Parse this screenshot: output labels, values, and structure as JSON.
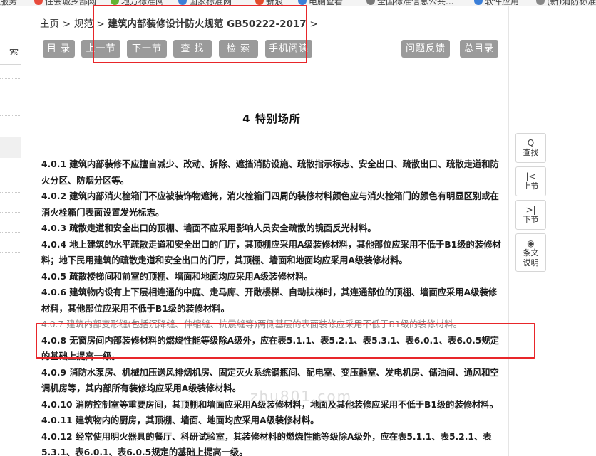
{
  "bookmarks": [
    {
      "label": "服务",
      "color": "#ffffff"
    },
    {
      "label": "住会城乡部网",
      "color": "#e84b3c"
    },
    {
      "label": "地方标准网",
      "color": "#62b432"
    },
    {
      "label": "国家标准网",
      "color": "#3b7fd8"
    },
    {
      "label": "新浪",
      "color": "#e34c2c"
    },
    {
      "label": "电脑查看",
      "color": "#3b7fd8"
    },
    {
      "label": "全国标准信息公共...",
      "color": "#7a7a7a"
    },
    {
      "label": "软件应用",
      "color": "#3b7fd8"
    },
    {
      "label": "(新)消防标准",
      "color": "#888888"
    }
  ],
  "sidebar": {
    "search_label": "索"
  },
  "breadcrumb": {
    "home": "主页",
    "sep": ">",
    "section": "规范",
    "current": "建筑内部装修设计防火规范 GB50222-2017",
    "tail": ">"
  },
  "toolbar": {
    "toc": "目 录",
    "prev": "上一节",
    "next": "下一节",
    "find": "查 找",
    "search": "检 索",
    "mobile": "手机阅读",
    "feedback": "问题反馈",
    "master_toc": "总目录"
  },
  "chapter": {
    "title": "4  特别场所"
  },
  "clauses": [
    {
      "id": "4.0.1",
      "text": "4.0.1 建筑内部装修不应擅自减少、改动、拆除、遮挡消防设施、疏散指示标志、安全出口、疏散出口、疏散走道和防火分区、防烟分区等。"
    },
    {
      "id": "4.0.2",
      "text": "4.0.2 建筑内部消火栓箱门不应被装饰物遮掩，消火栓箱门四周的装修材料颜色应与消火栓箱门的颜色有明显区别或在消火栓箱门表面设置发光标志。"
    },
    {
      "id": "4.0.3",
      "text": "4.0.3 疏散走道和安全出口的顶棚、墙面不应采用影响人员安全疏散的镜面反光材料。"
    },
    {
      "id": "4.0.4",
      "text": "4.0.4 地上建筑的水平疏散走道和安全出口的门厅，其顶棚应采用A级装修材料，其他部位应采用不低于B1级的装修材料；地下民用建筑的疏散走道和安全出口的门厅，其顶棚、墙面和地面均应采用A级装修材料。"
    },
    {
      "id": "4.0.5",
      "text": "4.0.5 疏散楼梯间和前室的顶棚、墙面和地面均应采用A级装修材料。"
    },
    {
      "id": "4.0.6",
      "text": "4.0.6 建筑物内设有上下层相连通的中庭、走马廊、开敞楼梯、自动扶梯时，其连通部位的顶棚、墙面应采用A级装修材料，其他部位应采用不低于B1级的装修材料。"
    },
    {
      "id": "4.0.7",
      "text": "4.0.7 建筑内部变形缝(包括沉降缝、伸缩缝、抗震缝等)两侧基层的表面装修应采用不低于B1级的装修材料。"
    },
    {
      "id": "4.0.8",
      "text": "4.0.8 无窗房间内部装修材料的燃烧性能等级除A级外，应在表5.1.1、表5.2.1、表5.3.1、表6.0.1、表6.0.5规定的基础上提高一级。"
    },
    {
      "id": "4.0.9",
      "text": "4.0.9 消防水泵房、机械加压送风排烟机房、固定灭火系统钢瓶间、配电室、变压器室、发电机房、储油间、通风和空调机房等，其内部所有装修均应采用A级装修材料。"
    },
    {
      "id": "4.0.10",
      "text": "4.0.10 消防控制室等重要房间，其顶棚和墙面应采用A级装修材料，地面及其他装修应采用不低于B1级的装修材料。"
    },
    {
      "id": "4.0.11",
      "text": "4.0.11 建筑物内的厨房，其顶棚、墙面、地面均应采用A级装修材料。"
    },
    {
      "id": "4.0.12",
      "text": "4.0.12 经常使用明火器具的餐厅、科研试验室，其装修材料的燃烧性能等级除A级外，应在表5.1.1、表5.2.1、表5.3.1、表6.0.1、表6.0.5规定的基础上提高一级。"
    }
  ],
  "side_tools": {
    "find": {
      "icon": "magnifier-icon",
      "glyph": "Q",
      "label": "查找"
    },
    "prev": {
      "icon": "prev-icon",
      "glyph": "|<",
      "label": "上节"
    },
    "next": {
      "icon": "next-icon",
      "glyph": ">|",
      "label": "下节"
    },
    "explain": {
      "icon": "eye-icon",
      "glyph": "◉",
      "label": "条文说明"
    }
  },
  "watermark": "zhu801.com"
}
